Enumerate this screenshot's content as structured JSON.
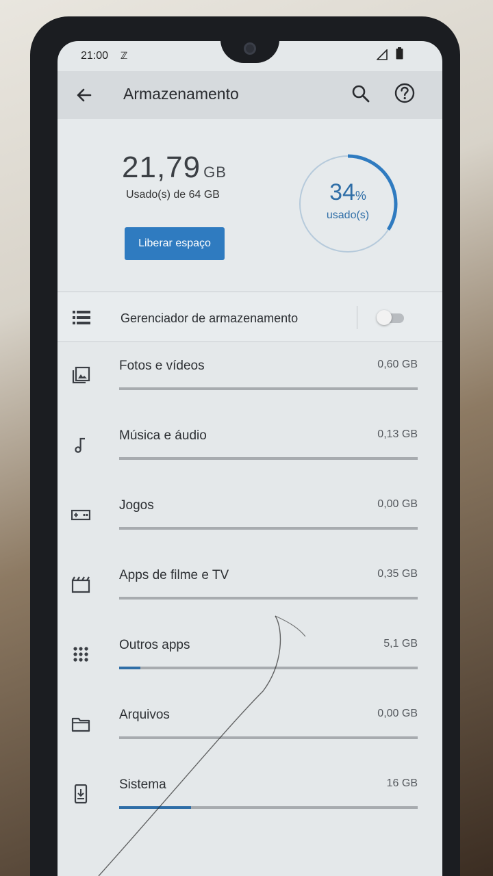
{
  "status_bar": {
    "time": "21:00",
    "notification_glyph": "ℤ"
  },
  "app_bar": {
    "title": "Armazenamento",
    "back_icon": "arrow-back-icon",
    "search_icon": "search-icon",
    "help_icon": "help-icon"
  },
  "summary": {
    "used_value": "21,79",
    "used_unit": "GB",
    "caption": "Usado(s) de 64 GB",
    "free_button_label": "Liberar espaço",
    "percent_value": "34",
    "percent_sign": "%",
    "percent_label": "usado(s)",
    "percent_fraction": 0.34,
    "accent_color": "#2f7bc0"
  },
  "manager": {
    "label": "Gerenciador de armazenamento",
    "enabled": false
  },
  "categories": [
    {
      "label": "Fotos e vídeos",
      "size": "0,60 GB",
      "fraction": 0.0,
      "icon": "photos-icon"
    },
    {
      "label": "Música e áudio",
      "size": "0,13 GB",
      "fraction": 0.0,
      "icon": "music-note-icon"
    },
    {
      "label": "Jogos",
      "size": "0,00 GB",
      "fraction": 0.0,
      "icon": "gamepad-icon"
    },
    {
      "label": "Apps de filme e TV",
      "size": "0,35 GB",
      "fraction": 0.0,
      "icon": "movie-icon"
    },
    {
      "label": "Outros apps",
      "size": "5,1 GB",
      "fraction": 0.07,
      "icon": "apps-grid-icon"
    },
    {
      "label": "Arquivos",
      "size": "0,00 GB",
      "fraction": 0.0,
      "icon": "folder-icon"
    },
    {
      "label": "Sistema",
      "size": "16 GB",
      "fraction": 0.24,
      "icon": "system-update-icon"
    }
  ]
}
